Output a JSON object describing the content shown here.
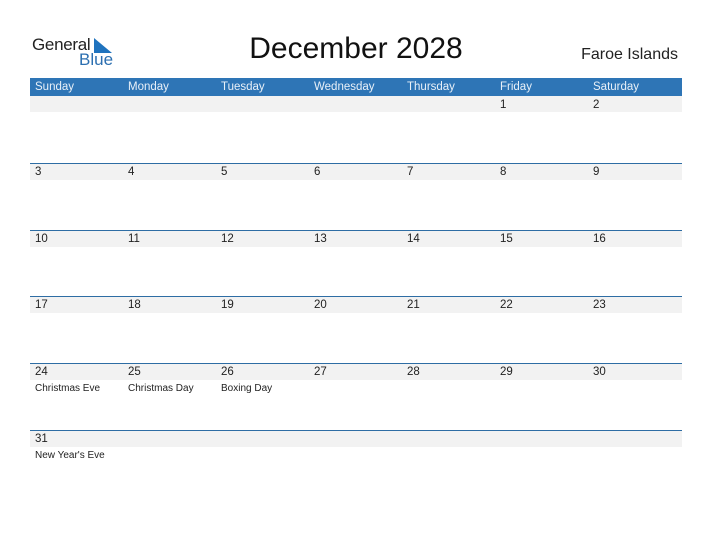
{
  "logo": {
    "general": "General",
    "blue": "Blue"
  },
  "title": "December 2028",
  "country": "Faroe Islands",
  "weekdays": [
    "Sunday",
    "Monday",
    "Tuesday",
    "Wednesday",
    "Thursday",
    "Friday",
    "Saturday"
  ],
  "weeks": [
    [
      {
        "day": ""
      },
      {
        "day": ""
      },
      {
        "day": ""
      },
      {
        "day": ""
      },
      {
        "day": ""
      },
      {
        "day": "1"
      },
      {
        "day": "2"
      }
    ],
    [
      {
        "day": "3"
      },
      {
        "day": "4"
      },
      {
        "day": "5"
      },
      {
        "day": "6"
      },
      {
        "day": "7"
      },
      {
        "day": "8"
      },
      {
        "day": "9"
      }
    ],
    [
      {
        "day": "10"
      },
      {
        "day": "11"
      },
      {
        "day": "12"
      },
      {
        "day": "13"
      },
      {
        "day": "14"
      },
      {
        "day": "15"
      },
      {
        "day": "16"
      }
    ],
    [
      {
        "day": "17"
      },
      {
        "day": "18"
      },
      {
        "day": "19"
      },
      {
        "day": "20"
      },
      {
        "day": "21"
      },
      {
        "day": "22"
      },
      {
        "day": "23"
      }
    ],
    [
      {
        "day": "24",
        "holiday": "Christmas Eve"
      },
      {
        "day": "25",
        "holiday": "Christmas Day"
      },
      {
        "day": "26",
        "holiday": "Boxing Day"
      },
      {
        "day": "27"
      },
      {
        "day": "28"
      },
      {
        "day": "29"
      },
      {
        "day": "30"
      }
    ],
    [
      {
        "day": "31",
        "holiday": "New Year's Eve"
      }
    ]
  ],
  "colors": {
    "header": "#2e75b6",
    "strip": "#f2f2f2",
    "rule": "#2e6da4"
  }
}
